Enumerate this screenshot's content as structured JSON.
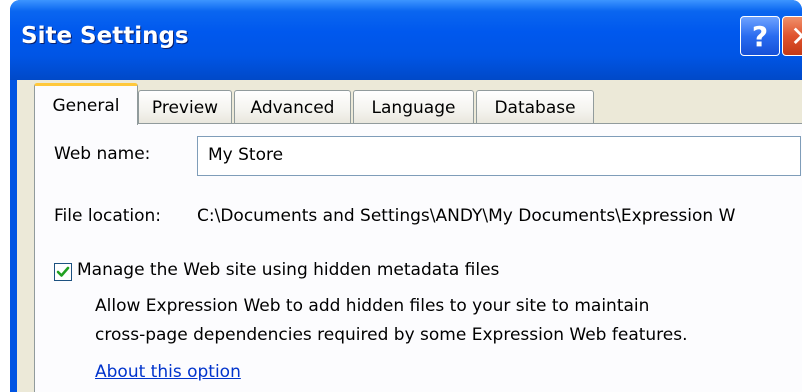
{
  "window": {
    "title": "Site Settings",
    "help_glyph": "?",
    "close_glyph": "✕"
  },
  "tabs": [
    {
      "label": "General",
      "selected": true
    },
    {
      "label": "Preview",
      "selected": false
    },
    {
      "label": "Advanced",
      "selected": false
    },
    {
      "label": "Language",
      "selected": false
    },
    {
      "label": "Database",
      "selected": false
    }
  ],
  "general": {
    "web_name_label": "Web name:",
    "web_name_value": "My Store",
    "file_location_label": "File location:",
    "file_location_value": "C:\\Documents and Settings\\ANDY\\My Documents\\Expression W",
    "metadata_checkbox_label": "Manage the Web site using hidden metadata files",
    "metadata_checked": true,
    "metadata_description_line1": "Allow Expression Web to add hidden files to your site to maintain",
    "metadata_description_line2": "cross-page dependencies required by some Expression Web features.",
    "about_link": "About this option"
  },
  "colors": {
    "title_bar": "#0054e3",
    "dialog_face": "#ece9d8",
    "selected_tab_accent": "#ffc83c",
    "link": "#0033cc",
    "check_mark": "#21a121"
  },
  "icons": {
    "help": "question-mark-icon",
    "close": "close-x-icon",
    "check": "checkmark-icon"
  }
}
